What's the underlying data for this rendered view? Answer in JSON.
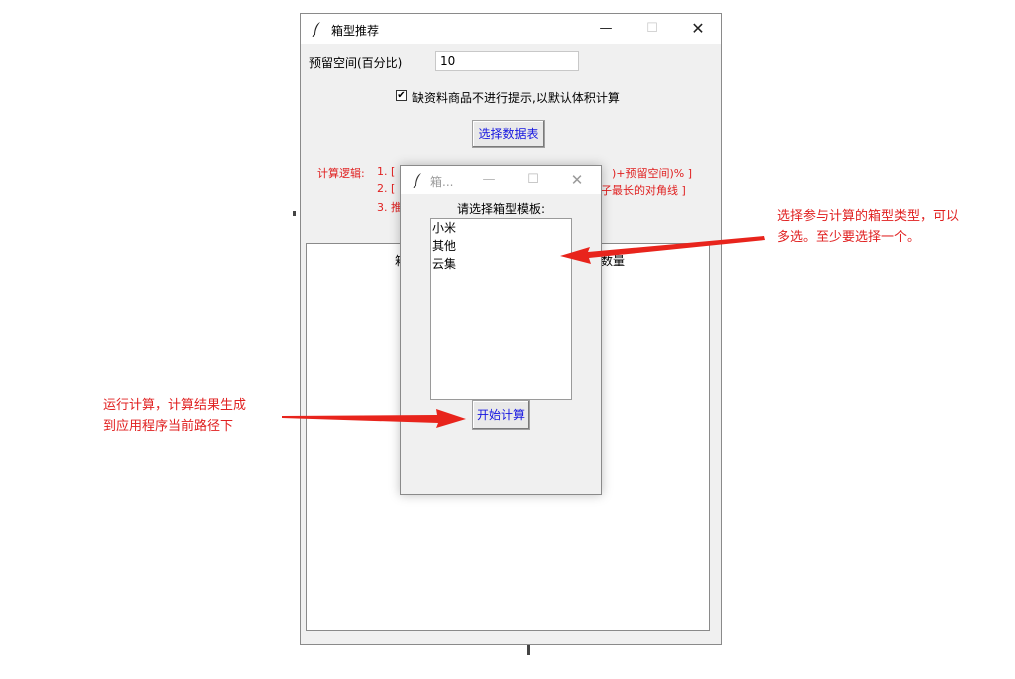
{
  "main_window": {
    "title": "箱型推荐",
    "reserve_label": "预留空间(百分比)",
    "reserve_value": "10",
    "checkbox": {
      "label": "缺资料商品不进行提示,以默认体积计算",
      "checked": true,
      "mark": "✔"
    },
    "select_table_button": "选择数据表",
    "logic": {
      "title": "计算逻辑:",
      "line1": "1. [",
      "line1_right": ")+预留空间)% ]",
      "line2": "2. [",
      "line2_right": "子最长的对角线 ]",
      "line3": "3. 推"
    },
    "results_header_fragments": [
      "箱",
      "数量"
    ]
  },
  "dialog": {
    "title": "箱...",
    "prompt": "请选择箱型模板:",
    "options": [
      "小米",
      "其他",
      "云集"
    ],
    "start_button": "开始计算"
  },
  "window_controls": {
    "minimize": "—",
    "maximize": "☐",
    "close": "✕"
  },
  "annotations": {
    "right": [
      "选择参与计算的箱型类型，可以",
      "多选。至少要选择一个。"
    ],
    "left": [
      "运行计算，计算结果生成",
      "到应用程序当前路径下"
    ]
  },
  "colors": {
    "annotation": "#e02020",
    "button_text": "#1515e0",
    "logic_text": "#e02020"
  }
}
